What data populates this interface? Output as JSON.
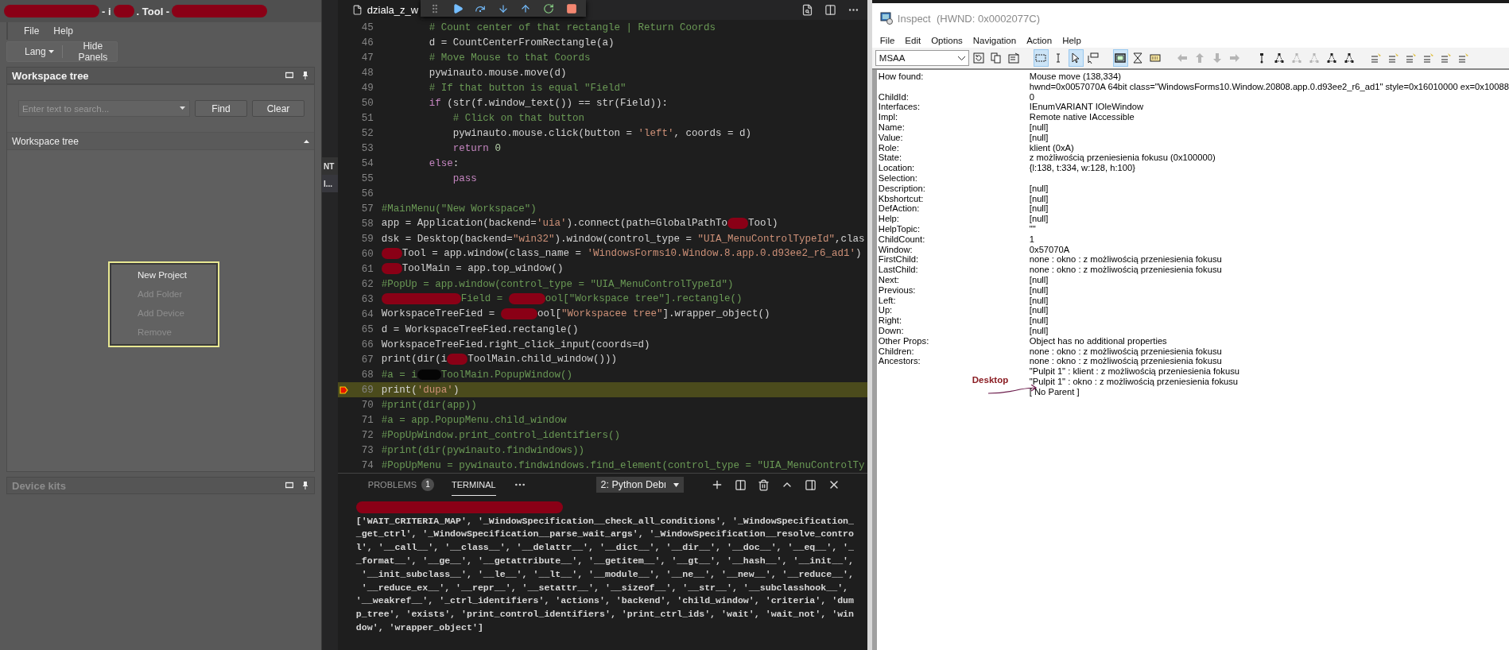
{
  "tool_window": {
    "title": [
      {
        "kind": "redaction-long"
      },
      {
        "kind": "text",
        "text": "- i"
      },
      {
        "kind": "redaction-short"
      },
      {
        "kind": "text",
        "text": ". Tool -"
      },
      {
        "kind": "redaction-long"
      }
    ],
    "menu": [
      "File",
      "Help"
    ],
    "toolbar": [
      {
        "label": "Lang",
        "dropdown": true
      },
      {
        "label": "Hide Panels",
        "dropdown": false
      }
    ],
    "workspace_panel": {
      "title": "Workspace tree",
      "search": {
        "placeholder": "Enter text to search..."
      },
      "buttons": [
        "Find",
        "Clear"
      ],
      "tree_header": {
        "title": "Workspace tree",
        "expanded": true
      },
      "context_menu": [
        {
          "label": "New Project",
          "disabled": false
        },
        {
          "label": "Add Folder",
          "disabled": true
        },
        {
          "label": "Add Device",
          "disabled": true
        },
        {
          "label": "Remove",
          "disabled": true
        }
      ]
    },
    "device_kits_panel": {
      "title": "Device kits",
      "disabled": true
    }
  },
  "hidden_sidebar": [
    "NT",
    "l..."
  ],
  "editor": {
    "tab": {
      "label": "dziala_z_w",
      "selected": true
    },
    "debug_toolbar": [
      {
        "kind": "grip"
      },
      {
        "kind": "continue"
      },
      {
        "kind": "step-over"
      },
      {
        "kind": "step-into"
      },
      {
        "kind": "step-out"
      },
      {
        "kind": "restart"
      },
      {
        "kind": "stop"
      }
    ],
    "lines": [
      {
        "number": "45",
        "current": false,
        "breakpoint": false,
        "segments": [
          {
            "kind": "comment",
            "text": "        # Count center of that rectangle | Return Coords"
          }
        ]
      },
      {
        "number": "46",
        "current": false,
        "breakpoint": false,
        "segments": [
          {
            "kind": "plain",
            "text": "        d = CountCenterFromRectangle(a)"
          }
        ]
      },
      {
        "number": "47",
        "current": false,
        "breakpoint": false,
        "segments": [
          {
            "kind": "comment",
            "text": "        # Move Mouse to that Coords"
          }
        ]
      },
      {
        "number": "48",
        "current": false,
        "breakpoint": false,
        "segments": [
          {
            "kind": "plain",
            "text": "        pywinauto.mouse.move(d)"
          }
        ]
      },
      {
        "number": "49",
        "current": false,
        "breakpoint": false,
        "segments": [
          {
            "kind": "comment",
            "text": "        # If that button is equal \"Field\""
          }
        ]
      },
      {
        "number": "50",
        "current": false,
        "breakpoint": false,
        "segments": [
          {
            "kind": "keyword",
            "text": "        if"
          },
          {
            "kind": "plain",
            "text": " (str(f.window_text()) == str(Field)):"
          }
        ]
      },
      {
        "number": "51",
        "current": false,
        "breakpoint": false,
        "segments": [
          {
            "kind": "comment",
            "text": "            # Click on that button"
          }
        ]
      },
      {
        "number": "52",
        "current": false,
        "breakpoint": false,
        "segments": [
          {
            "kind": "plain",
            "text": "            pywinauto.mouse.click(button = "
          },
          {
            "kind": "string",
            "text": "'left'"
          },
          {
            "kind": "plain",
            "text": ", coords = d)"
          }
        ]
      },
      {
        "number": "53",
        "current": false,
        "breakpoint": false,
        "segments": [
          {
            "kind": "keyword",
            "text": "            return"
          },
          {
            "kind": "number",
            "text": " 0"
          }
        ]
      },
      {
        "number": "54",
        "current": false,
        "breakpoint": false,
        "segments": [
          {
            "kind": "keyword",
            "text": "        else"
          },
          {
            "kind": "plain",
            "text": ":"
          }
        ]
      },
      {
        "number": "55",
        "current": false,
        "breakpoint": false,
        "segments": [
          {
            "kind": "keyword",
            "text": "            pass"
          }
        ]
      },
      {
        "number": "56",
        "current": false,
        "breakpoint": false
      },
      {
        "number": "57",
        "current": false,
        "breakpoint": false,
        "segments": [
          {
            "kind": "comment",
            "text": "#MainMenu(\"New Workspace\")"
          }
        ]
      },
      {
        "number": "58",
        "current": false,
        "breakpoint": false,
        "segments": [
          {
            "kind": "plain",
            "text": "app = Application(backend="
          },
          {
            "kind": "string",
            "text": "'uia'"
          },
          {
            "kind": "plain",
            "text": ").connect(path=GlobalPathTo"
          },
          {
            "kind": "redaction-short"
          },
          {
            "kind": "plain",
            "text": "Tool)"
          }
        ]
      },
      {
        "number": "59",
        "current": false,
        "breakpoint": false,
        "segments": [
          {
            "kind": "plain",
            "text": "dsk = Desktop(backend="
          },
          {
            "kind": "string",
            "text": "\"win32\""
          },
          {
            "kind": "plain",
            "text": ").window(control_type = "
          },
          {
            "kind": "string",
            "text": "\"UIA_MenuControlTypeId\""
          },
          {
            "kind": "plain",
            "text": ",clas"
          }
        ]
      },
      {
        "number": "60",
        "current": false,
        "breakpoint": false,
        "segments": [
          {
            "kind": "redaction-short"
          },
          {
            "kind": "plain",
            "text": "Tool = app.window(class_name = "
          },
          {
            "kind": "string",
            "text": "'WindowsForms10.Window.8.app.0.d93ee2_r6_ad1'"
          },
          {
            "kind": "plain",
            "text": ")"
          }
        ]
      },
      {
        "number": "61",
        "current": false,
        "breakpoint": false,
        "segments": [
          {
            "kind": "redaction-short"
          },
          {
            "kind": "plain",
            "text": "ToolMain = app.top_window()"
          }
        ]
      },
      {
        "number": "62",
        "current": false,
        "breakpoint": false,
        "segments": [
          {
            "kind": "comment",
            "text": "#PopUp = app.window(control_type = \"UIA_MenuControlTypeId\")"
          }
        ]
      },
      {
        "number": "63",
        "current": false,
        "breakpoint": false,
        "segments": [
          {
            "kind": "redaction-long"
          },
          {
            "kind": "comment",
            "text": "Field = "
          },
          {
            "kind": "redaction-medium"
          },
          {
            "kind": "comment",
            "text": "ool[\"Workspace tree\"].rectangle()"
          }
        ]
      },
      {
        "number": "64",
        "current": false,
        "breakpoint": false,
        "segments": [
          {
            "kind": "plain",
            "text": "WorkspaceTreeFied = "
          },
          {
            "kind": "redaction-medium"
          },
          {
            "kind": "plain",
            "text": "ool["
          },
          {
            "kind": "string",
            "text": "\"Workspacee tree\""
          },
          {
            "kind": "plain",
            "text": "].wrapper_object()"
          }
        ]
      },
      {
        "number": "65",
        "current": false,
        "breakpoint": false,
        "segments": [
          {
            "kind": "plain",
            "text": "d = WorkspaceTreeFied.rectangle()"
          }
        ]
      },
      {
        "number": "66",
        "current": false,
        "breakpoint": false,
        "segments": [
          {
            "kind": "plain",
            "text": "WorkspaceTreeFied.right_click_input(coords=d)"
          }
        ]
      },
      {
        "number": "67",
        "current": false,
        "breakpoint": false,
        "segments": [
          {
            "kind": "plain",
            "text": "print(dir(i"
          },
          {
            "kind": "redaction-short"
          },
          {
            "kind": "plain",
            "text": "ToolMain.child_window()))"
          }
        ]
      },
      {
        "number": "68",
        "current": false,
        "breakpoint": false,
        "segments": [
          {
            "kind": "comment",
            "text": "#a = i"
          },
          {
            "kind": "blackout"
          },
          {
            "kind": "comment",
            "text": "ToolMain.PopupWindow()"
          }
        ]
      },
      {
        "number": "69",
        "current": true,
        "breakpoint": true,
        "segments": [
          {
            "kind": "plain",
            "text": "print("
          },
          {
            "kind": "string",
            "text": "'dupa'"
          },
          {
            "kind": "plain",
            "text": ")"
          }
        ]
      },
      {
        "number": "70",
        "current": false,
        "breakpoint": false,
        "segments": [
          {
            "kind": "comment",
            "text": "#print(dir(app))"
          }
        ]
      },
      {
        "number": "71",
        "current": false,
        "breakpoint": false,
        "segments": [
          {
            "kind": "comment",
            "text": "#a = app.PopupMenu.child_window"
          }
        ]
      },
      {
        "number": "72",
        "current": false,
        "breakpoint": false,
        "segments": [
          {
            "kind": "comment",
            "text": "#PopUpWindow.print_control_identifiers()"
          }
        ]
      },
      {
        "number": "73",
        "current": false,
        "breakpoint": false,
        "segments": [
          {
            "kind": "comment",
            "text": "#print(dir(pywinauto.findwindows))"
          }
        ]
      },
      {
        "number": "74",
        "current": false,
        "breakpoint": false,
        "segments": [
          {
            "kind": "comment",
            "text": "#PopUpMenu = pywinauto.findwindows.find_element(control_type = \"UIA_MenuControlTy"
          }
        ]
      }
    ]
  },
  "panel": {
    "tabs": [
      {
        "label": "PROBLEMS",
        "badge": "1",
        "selected": false
      },
      {
        "label": "TERMINAL",
        "selected": true
      }
    ],
    "terminal_select": "2: Python Debı",
    "lines": [
      {
        "kind": "redacted"
      },
      {
        "kind": "text",
        "text": "['WAIT_CRITERIA_MAP', '_WindowSpecification__check_all_conditions', '_WindowSpecification_"
      },
      {
        "kind": "text",
        "text": "_get_ctrl', '_WindowSpecification__parse_wait_args', '_WindowSpecification__resolve_contro"
      },
      {
        "kind": "text",
        "text": "l', '__call__', '__class__', '__delattr__', '__dict__', '__dir__', '__doc__', '__eq__', '_"
      },
      {
        "kind": "text",
        "text": "_format__', '__ge__', '__getattribute__', '__getitem__', '__gt__', '__hash__', '__init__',"
      },
      {
        "kind": "text",
        "text": " '__init_subclass__', '__le__', '__lt__', '__module__', '__ne__', '__new__', '__reduce__',"
      },
      {
        "kind": "text",
        "text": " '__reduce_ex__', '__repr__', '__setattr__', '__sizeof__', '__str__', '__subclasshook__',"
      },
      {
        "kind": "text",
        "text": "'__weakref__', '_ctrl_identifiers', 'actions', 'backend', 'child_window', 'criteria', 'dum"
      },
      {
        "kind": "text",
        "text": "p_tree', 'exists', 'print_control_identifiers', 'print_ctrl_ids', 'wait', 'wait_not', 'win"
      },
      {
        "kind": "text",
        "text": "dow', 'wrapper_object']"
      }
    ]
  },
  "inspect": {
    "title": "Inspect  (HWND: 0x0002077C)",
    "menu": [
      "File",
      "Edit",
      "Options",
      "Navigation",
      "Action",
      "Help"
    ],
    "mode": "MSAA",
    "toolbar": [
      {
        "kind": "refresh",
        "pressed": false,
        "disabled": false
      },
      {
        "kind": "copy",
        "pressed": false,
        "disabled": false
      },
      {
        "kind": "properties",
        "pressed": false,
        "disabled": false
      },
      {
        "kind": "separator"
      },
      {
        "kind": "rectangle",
        "pressed": true,
        "disabled": false
      },
      {
        "kind": "ibeam",
        "pressed": false,
        "disabled": false
      },
      {
        "kind": "pointer",
        "pressed": true,
        "disabled": false
      },
      {
        "kind": "hover",
        "pressed": false,
        "disabled": false
      },
      {
        "kind": "separator"
      },
      {
        "kind": "frame",
        "pressed": true,
        "disabled": false
      },
      {
        "kind": "hourglass",
        "pressed": false,
        "disabled": false
      },
      {
        "kind": "keyboard",
        "pressed": false,
        "disabled": false
      },
      {
        "kind": "separator"
      },
      {
        "kind": "arrow-left",
        "pressed": false,
        "disabled": true
      },
      {
        "kind": "arrow-up",
        "pressed": false,
        "disabled": true
      },
      {
        "kind": "arrow-down",
        "pressed": false,
        "disabled": true
      },
      {
        "kind": "arrow-right",
        "pressed": false,
        "disabled": true
      },
      {
        "kind": "separator"
      },
      {
        "kind": "parent",
        "pressed": false,
        "disabled": false
      },
      {
        "kind": "tree",
        "pressed": false,
        "disabled": false
      },
      {
        "kind": "tree",
        "pressed": false,
        "disabled": true
      },
      {
        "kind": "tree",
        "pressed": false,
        "disabled": true
      },
      {
        "kind": "tree",
        "pressed": false,
        "disabled": false
      },
      {
        "kind": "tree",
        "pressed": false,
        "disabled": false
      },
      {
        "kind": "separator"
      },
      {
        "kind": "edit",
        "pressed": false,
        "disabled": false
      },
      {
        "kind": "edit",
        "pressed": false,
        "disabled": false
      },
      {
        "kind": "edit",
        "pressed": false,
        "disabled": false
      },
      {
        "kind": "edit",
        "pressed": false,
        "disabled": false
      },
      {
        "kind": "edit",
        "pressed": false,
        "disabled": false
      },
      {
        "kind": "edit",
        "pressed": false,
        "disabled": false
      }
    ],
    "properties": [
      {
        "label": "How found:",
        "values": [
          "Mouse move (138,334)",
          "hwnd=0x0057070A 64bit class=\"WindowsForms10.Window.20808.app.0.d93ee2_r6_ad1\" style=0x16010000 ex=0x10088"
        ]
      },
      {
        "label": "ChildId:",
        "values": [
          "0"
        ]
      },
      {
        "label": "Interfaces:",
        "values": [
          "IEnumVARIANT IOleWindow"
        ]
      },
      {
        "label": "Impl:",
        "values": [
          "Remote native IAccessible"
        ]
      },
      {
        "label": "Name:",
        "values": [
          "[null]"
        ]
      },
      {
        "label": "Value:",
        "values": [
          "[null]"
        ]
      },
      {
        "label": "Role:",
        "values": [
          "klient (0xA)"
        ]
      },
      {
        "label": "State:",
        "values": [
          "z możliwością przeniesienia fokusu (0x100000)"
        ]
      },
      {
        "label": "Location:",
        "values": [
          "{l:138, t:334, w:128, h:100}"
        ]
      },
      {
        "label": "Selection:"
      },
      {
        "label": "Description:",
        "values": [
          "[null]"
        ]
      },
      {
        "label": "Kbshortcut:",
        "values": [
          "[null]"
        ]
      },
      {
        "label": "DefAction:",
        "values": [
          "[null]"
        ]
      },
      {
        "label": "Help:",
        "values": [
          "[null]"
        ]
      },
      {
        "label": "HelpTopic:",
        "values": [
          "\"\""
        ]
      },
      {
        "label": "ChildCount:",
        "values": [
          "1"
        ]
      },
      {
        "label": "Window:",
        "values": [
          "0x57070A"
        ]
      },
      {
        "label": "FirstChild:",
        "values": [
          "none : okno : z możliwością przeniesienia fokusu"
        ]
      },
      {
        "label": "LastChild:",
        "values": [
          "none : okno : z możliwością przeniesienia fokusu"
        ]
      },
      {
        "label": "Next:",
        "values": [
          "[null]"
        ]
      },
      {
        "label": "Previous:",
        "values": [
          "[null]"
        ]
      },
      {
        "label": "Left:",
        "values": [
          "[null]"
        ]
      },
      {
        "label": "Up:",
        "values": [
          "[null]"
        ]
      },
      {
        "label": "Right:",
        "values": [
          "[null]"
        ]
      },
      {
        "label": "Down:",
        "values": [
          "[null]"
        ]
      },
      {
        "label": "Other Props:",
        "values": [
          "Object has no additional properties"
        ]
      },
      {
        "label": "Children:",
        "values": [
          "none : okno : z możliwością przeniesienia fokusu"
        ]
      },
      {
        "label": "Ancestors:",
        "values": [
          "none : okno : z możliwością przeniesienia fokusu",
          "\"Pulpit 1\" : klient : z możliwością przeniesienia fokusu",
          "\"Pulpit 1\" : okno : z możliwością przeniesienia fokusu",
          "[ No Parent ]"
        ]
      }
    ],
    "annotation": "Desktop"
  }
}
